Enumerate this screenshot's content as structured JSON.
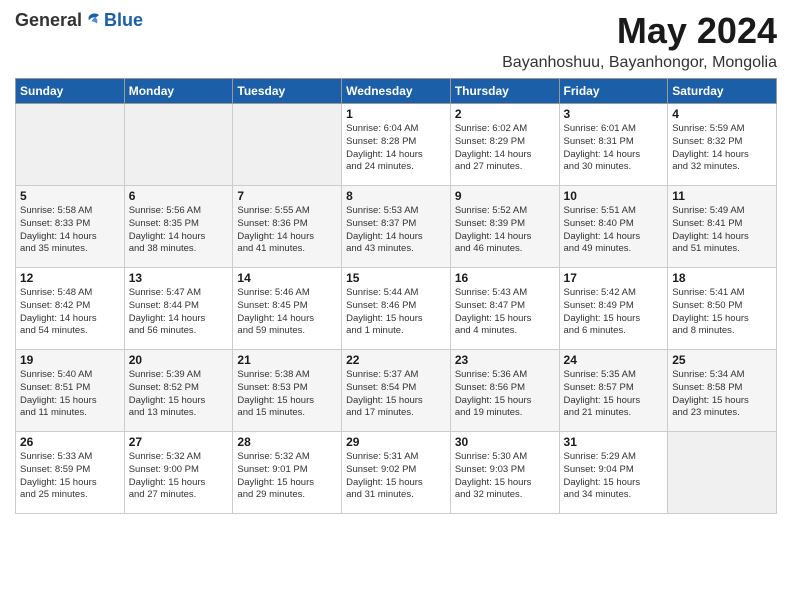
{
  "logo": {
    "general": "General",
    "blue": "Blue"
  },
  "title": "May 2024",
  "subtitle": "Bayanhoshuu, Bayanhongor, Mongolia",
  "days_of_week": [
    "Sunday",
    "Monday",
    "Tuesday",
    "Wednesday",
    "Thursday",
    "Friday",
    "Saturday"
  ],
  "weeks": [
    [
      {
        "day": "",
        "info": ""
      },
      {
        "day": "",
        "info": ""
      },
      {
        "day": "",
        "info": ""
      },
      {
        "day": "1",
        "info": "Sunrise: 6:04 AM\nSunset: 8:28 PM\nDaylight: 14 hours\nand 24 minutes."
      },
      {
        "day": "2",
        "info": "Sunrise: 6:02 AM\nSunset: 8:29 PM\nDaylight: 14 hours\nand 27 minutes."
      },
      {
        "day": "3",
        "info": "Sunrise: 6:01 AM\nSunset: 8:31 PM\nDaylight: 14 hours\nand 30 minutes."
      },
      {
        "day": "4",
        "info": "Sunrise: 5:59 AM\nSunset: 8:32 PM\nDaylight: 14 hours\nand 32 minutes."
      }
    ],
    [
      {
        "day": "5",
        "info": "Sunrise: 5:58 AM\nSunset: 8:33 PM\nDaylight: 14 hours\nand 35 minutes."
      },
      {
        "day": "6",
        "info": "Sunrise: 5:56 AM\nSunset: 8:35 PM\nDaylight: 14 hours\nand 38 minutes."
      },
      {
        "day": "7",
        "info": "Sunrise: 5:55 AM\nSunset: 8:36 PM\nDaylight: 14 hours\nand 41 minutes."
      },
      {
        "day": "8",
        "info": "Sunrise: 5:53 AM\nSunset: 8:37 PM\nDaylight: 14 hours\nand 43 minutes."
      },
      {
        "day": "9",
        "info": "Sunrise: 5:52 AM\nSunset: 8:39 PM\nDaylight: 14 hours\nand 46 minutes."
      },
      {
        "day": "10",
        "info": "Sunrise: 5:51 AM\nSunset: 8:40 PM\nDaylight: 14 hours\nand 49 minutes."
      },
      {
        "day": "11",
        "info": "Sunrise: 5:49 AM\nSunset: 8:41 PM\nDaylight: 14 hours\nand 51 minutes."
      }
    ],
    [
      {
        "day": "12",
        "info": "Sunrise: 5:48 AM\nSunset: 8:42 PM\nDaylight: 14 hours\nand 54 minutes."
      },
      {
        "day": "13",
        "info": "Sunrise: 5:47 AM\nSunset: 8:44 PM\nDaylight: 14 hours\nand 56 minutes."
      },
      {
        "day": "14",
        "info": "Sunrise: 5:46 AM\nSunset: 8:45 PM\nDaylight: 14 hours\nand 59 minutes."
      },
      {
        "day": "15",
        "info": "Sunrise: 5:44 AM\nSunset: 8:46 PM\nDaylight: 15 hours\nand 1 minute."
      },
      {
        "day": "16",
        "info": "Sunrise: 5:43 AM\nSunset: 8:47 PM\nDaylight: 15 hours\nand 4 minutes."
      },
      {
        "day": "17",
        "info": "Sunrise: 5:42 AM\nSunset: 8:49 PM\nDaylight: 15 hours\nand 6 minutes."
      },
      {
        "day": "18",
        "info": "Sunrise: 5:41 AM\nSunset: 8:50 PM\nDaylight: 15 hours\nand 8 minutes."
      }
    ],
    [
      {
        "day": "19",
        "info": "Sunrise: 5:40 AM\nSunset: 8:51 PM\nDaylight: 15 hours\nand 11 minutes."
      },
      {
        "day": "20",
        "info": "Sunrise: 5:39 AM\nSunset: 8:52 PM\nDaylight: 15 hours\nand 13 minutes."
      },
      {
        "day": "21",
        "info": "Sunrise: 5:38 AM\nSunset: 8:53 PM\nDaylight: 15 hours\nand 15 minutes."
      },
      {
        "day": "22",
        "info": "Sunrise: 5:37 AM\nSunset: 8:54 PM\nDaylight: 15 hours\nand 17 minutes."
      },
      {
        "day": "23",
        "info": "Sunrise: 5:36 AM\nSunset: 8:56 PM\nDaylight: 15 hours\nand 19 minutes."
      },
      {
        "day": "24",
        "info": "Sunrise: 5:35 AM\nSunset: 8:57 PM\nDaylight: 15 hours\nand 21 minutes."
      },
      {
        "day": "25",
        "info": "Sunrise: 5:34 AM\nSunset: 8:58 PM\nDaylight: 15 hours\nand 23 minutes."
      }
    ],
    [
      {
        "day": "26",
        "info": "Sunrise: 5:33 AM\nSunset: 8:59 PM\nDaylight: 15 hours\nand 25 minutes."
      },
      {
        "day": "27",
        "info": "Sunrise: 5:32 AM\nSunset: 9:00 PM\nDaylight: 15 hours\nand 27 minutes."
      },
      {
        "day": "28",
        "info": "Sunrise: 5:32 AM\nSunset: 9:01 PM\nDaylight: 15 hours\nand 29 minutes."
      },
      {
        "day": "29",
        "info": "Sunrise: 5:31 AM\nSunset: 9:02 PM\nDaylight: 15 hours\nand 31 minutes."
      },
      {
        "day": "30",
        "info": "Sunrise: 5:30 AM\nSunset: 9:03 PM\nDaylight: 15 hours\nand 32 minutes."
      },
      {
        "day": "31",
        "info": "Sunrise: 5:29 AM\nSunset: 9:04 PM\nDaylight: 15 hours\nand 34 minutes."
      },
      {
        "day": "",
        "info": ""
      }
    ]
  ]
}
